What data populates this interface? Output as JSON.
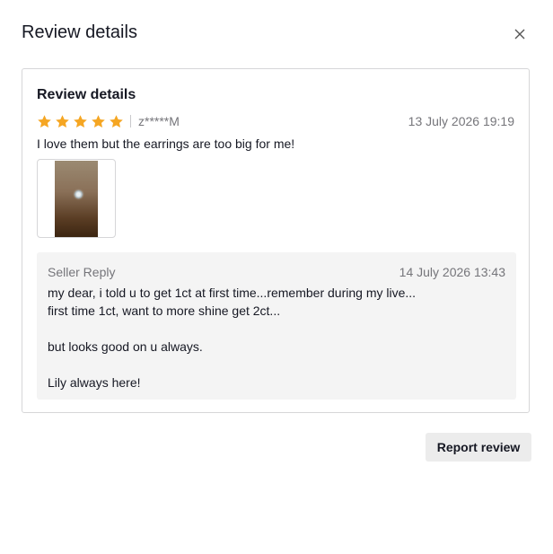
{
  "modal": {
    "title": "Review details",
    "close_icon": "close-icon"
  },
  "review": {
    "card_title": "Review details",
    "rating": 5,
    "max_rating": 5,
    "star_color": "#F5A623",
    "username": "z*****M",
    "date": "13 July 2026 19:19",
    "text": "I love them but the earrings are too big for me!"
  },
  "seller_reply": {
    "label": "Seller Reply",
    "date": "14 July 2026 13:43",
    "lines": [
      "my dear, i told u to get 1ct at first time...remember during my live...",
      "first time 1ct, want to more shine get 2ct...",
      "",
      "but looks good on u always.",
      "",
      "Lily always here!"
    ]
  },
  "actions": {
    "report_label": "Report review"
  }
}
